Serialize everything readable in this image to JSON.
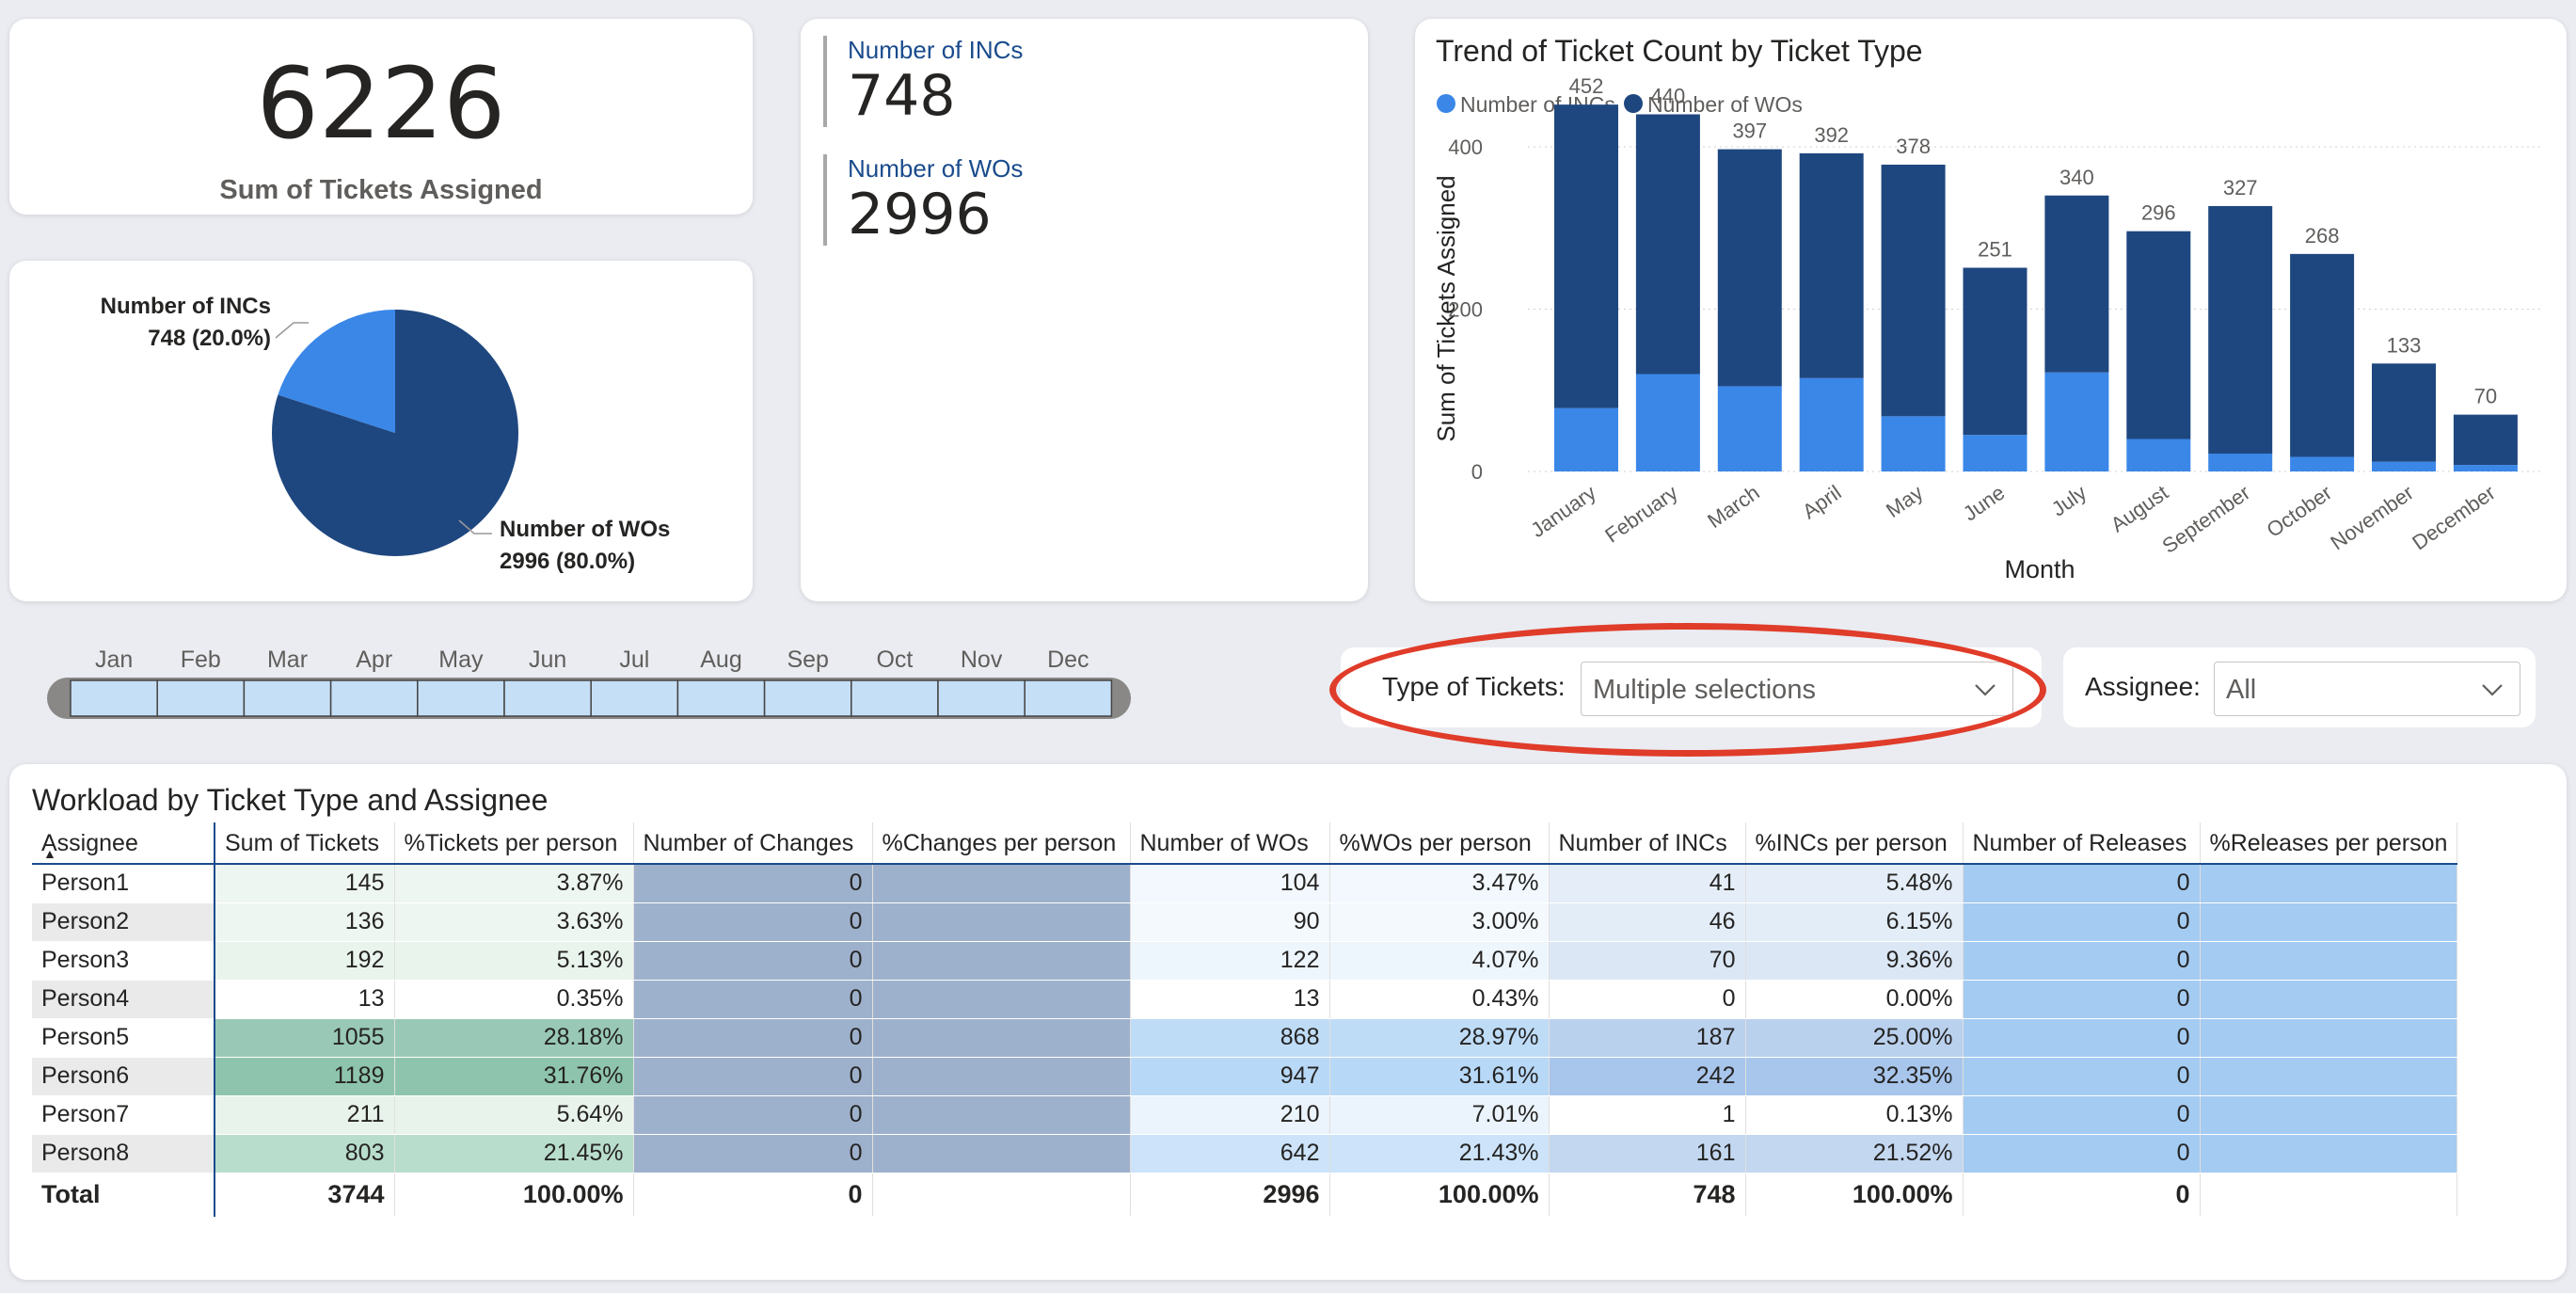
{
  "kpi": {
    "value": "6226",
    "label": "Sum of Tickets Assigned"
  },
  "pie": {
    "inc_label": "Number of INCs",
    "inc_value": "748 (20.0%)",
    "wo_label": "Number of WOs",
    "wo_value": "2996 (80.0%)",
    "inc_share": 0.2,
    "colors": {
      "inc": "#3a87e8",
      "wo": "#1f477f"
    }
  },
  "multi_card": {
    "rows": [
      {
        "label": "Number of INCs",
        "value": "748"
      },
      {
        "label": "Number of WOs",
        "value": "2996"
      }
    ]
  },
  "chart_data": {
    "type": "bar",
    "stacked": true,
    "title": "Trend of Ticket Count by Ticket Type",
    "xlabel": "Month",
    "ylabel": "Sum of Tickets Assigned",
    "ylim": [
      0,
      460
    ],
    "yticks": [
      0,
      200,
      400
    ],
    "legend_position": "top-left",
    "categories": [
      "January",
      "February",
      "March",
      "April",
      "May",
      "June",
      "July",
      "August",
      "September",
      "October",
      "November",
      "December"
    ],
    "totals": [
      452,
      440,
      397,
      392,
      378,
      251,
      340,
      296,
      327,
      268,
      133,
      70
    ],
    "series": [
      {
        "name": "Number of INCs",
        "color": "#3a87e8",
        "values": [
          78,
          120,
          105,
          115,
          68,
          45,
          122,
          40,
          22,
          18,
          12,
          8
        ]
      },
      {
        "name": "Number of WOs",
        "color": "#1f477f",
        "values": [
          374,
          320,
          292,
          277,
          310,
          206,
          218,
          256,
          305,
          250,
          121,
          62
        ]
      }
    ]
  },
  "month_slicer": {
    "months": [
      "Jan",
      "Feb",
      "Mar",
      "Apr",
      "May",
      "Jun",
      "Jul",
      "Aug",
      "Sep",
      "Oct",
      "Nov",
      "Dec"
    ]
  },
  "ticket_slicer": {
    "label": "Type of Tickets:",
    "value": "Multiple selections"
  },
  "assignee_slicer": {
    "label": "Assignee:",
    "value": "All"
  },
  "table": {
    "title": "Workload by Ticket Type and Assignee",
    "columns": [
      "Assignee",
      "Sum of Tickets",
      "%Tickets per person",
      "Number of Changes",
      "%Changes per person",
      "Number of WOs",
      "%WOs per person",
      "Number of INCs",
      "%INCs per person",
      "Number of Releases",
      "%Releases per person"
    ],
    "rows": [
      [
        "Person1",
        "145",
        "3.87%",
        "0",
        "",
        "104",
        "3.47%",
        "41",
        "5.48%",
        "0",
        ""
      ],
      [
        "Person2",
        "136",
        "3.63%",
        "0",
        "",
        "90",
        "3.00%",
        "46",
        "6.15%",
        "0",
        ""
      ],
      [
        "Person3",
        "192",
        "5.13%",
        "0",
        "",
        "122",
        "4.07%",
        "70",
        "9.36%",
        "0",
        ""
      ],
      [
        "Person4",
        "13",
        "0.35%",
        "0",
        "",
        "13",
        "0.43%",
        "0",
        "0.00%",
        "0",
        ""
      ],
      [
        "Person5",
        "1055",
        "28.18%",
        "0",
        "",
        "868",
        "28.97%",
        "187",
        "25.00%",
        "0",
        ""
      ],
      [
        "Person6",
        "1189",
        "31.76%",
        "0",
        "",
        "947",
        "31.61%",
        "242",
        "32.35%",
        "0",
        ""
      ],
      [
        "Person7",
        "211",
        "5.64%",
        "0",
        "",
        "210",
        "7.01%",
        "1",
        "0.13%",
        "0",
        ""
      ],
      [
        "Person8",
        "803",
        "21.45%",
        "0",
        "",
        "642",
        "21.43%",
        "161",
        "21.52%",
        "0",
        ""
      ]
    ],
    "total": [
      "Total",
      "3744",
      "100.00%",
      "0",
      "",
      "2996",
      "100.00%",
      "748",
      "100.00%",
      "0",
      ""
    ],
    "colors": {
      "tickets": [
        "#eef6f1",
        "#eef6f1",
        "#e9f4ed",
        "#ffffff",
        "#99c9b6",
        "#8ec4ad",
        "#e8f3ec",
        "#b9ddcd"
      ],
      "changes": "#9eb1cc",
      "wos": [
        "#f2f8fe",
        "#f4f9fe",
        "#eef6fd",
        "#ffffff",
        "#bfdcf7",
        "#b8d8f7",
        "#ebf4fd",
        "#cce3f9"
      ],
      "incs": [
        "#e5eef8",
        "#e3edf8",
        "#dbe7f5",
        "#ffffff",
        "#bad1ee",
        "#a8c6ec",
        "#ffffff",
        "#c3d7f0"
      ],
      "releases": "#a4cbf2"
    }
  }
}
